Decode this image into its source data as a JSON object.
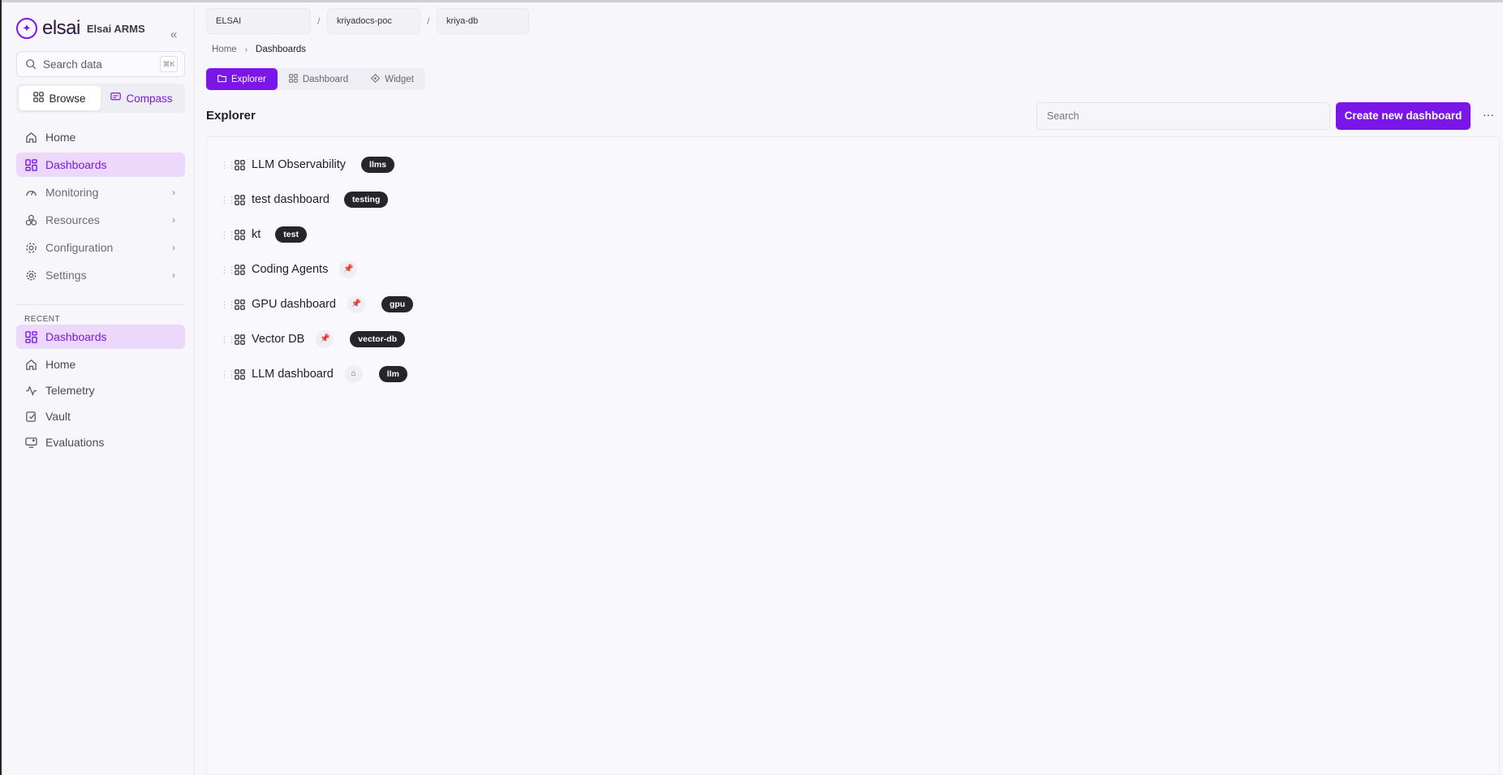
{
  "brand": {
    "logo_text": "elsai",
    "app_name": "Elsai ARMS"
  },
  "sidebar": {
    "search_placeholder": "Search data",
    "search_shortcut": "⌘K",
    "modes": [
      {
        "label": "Browse",
        "active": true
      },
      {
        "label": "Compass",
        "active": false
      }
    ],
    "nav_items": [
      {
        "label": "Home",
        "icon": "home-icon",
        "active": false,
        "has_chevron": false
      },
      {
        "label": "Dashboards",
        "icon": "dashboard-icon",
        "active": true,
        "has_chevron": false
      },
      {
        "label": "Monitoring",
        "icon": "gauge-icon",
        "active": false,
        "has_chevron": true
      },
      {
        "label": "Resources",
        "icon": "resources-icon",
        "active": false,
        "has_chevron": true
      },
      {
        "label": "Configuration",
        "icon": "config-icon",
        "active": false,
        "has_chevron": true
      },
      {
        "label": "Settings",
        "icon": "gear-icon",
        "active": false,
        "has_chevron": true
      }
    ],
    "recent_label": "RECENT",
    "recent_items": [
      {
        "label": "Dashboards",
        "icon": "dashboard-icon",
        "active": true
      },
      {
        "label": "Home",
        "icon": "home-icon",
        "active": false
      },
      {
        "label": "Telemetry",
        "icon": "activity-icon",
        "active": false
      },
      {
        "label": "Vault",
        "icon": "vault-icon",
        "active": false
      },
      {
        "label": "Evaluations",
        "icon": "monitor-icon",
        "active": false
      }
    ]
  },
  "context": {
    "org": "ELSAI",
    "project": "kriyadocs-poc",
    "database": "kriya-db",
    "separator": "/"
  },
  "breadcrumb": {
    "home": "Home",
    "current": "Dashboards"
  },
  "view_tabs": [
    {
      "label": "Explorer",
      "icon": "folder-icon",
      "active": true
    },
    {
      "label": "Dashboard",
      "icon": "dashboard-icon",
      "active": false
    },
    {
      "label": "Widget",
      "icon": "widget-icon",
      "active": false
    }
  ],
  "main": {
    "title": "Explorer",
    "search_placeholder": "Search",
    "create_label": "Create new dashboard",
    "more_label": "···"
  },
  "dashboards": [
    {
      "name": "LLM Observability",
      "badge_icon": "",
      "tag": "llms"
    },
    {
      "name": "test dashboard",
      "badge_icon": "",
      "tag": "testing"
    },
    {
      "name": "kt",
      "badge_icon": "",
      "tag": "test"
    },
    {
      "name": "Coding Agents",
      "badge_icon": "pin-icon",
      "tag": ""
    },
    {
      "name": "GPU dashboard",
      "badge_icon": "pin-icon",
      "tag": "gpu"
    },
    {
      "name": "Vector DB",
      "badge_icon": "pin-icon",
      "tag": "vector-db"
    },
    {
      "name": "LLM dashboard",
      "badge_icon": "home-icon",
      "tag": "llm"
    }
  ],
  "colors": {
    "accent": "#7b16e8",
    "active_bg": "#ecd8fb",
    "tag_bg": "#25252b"
  }
}
